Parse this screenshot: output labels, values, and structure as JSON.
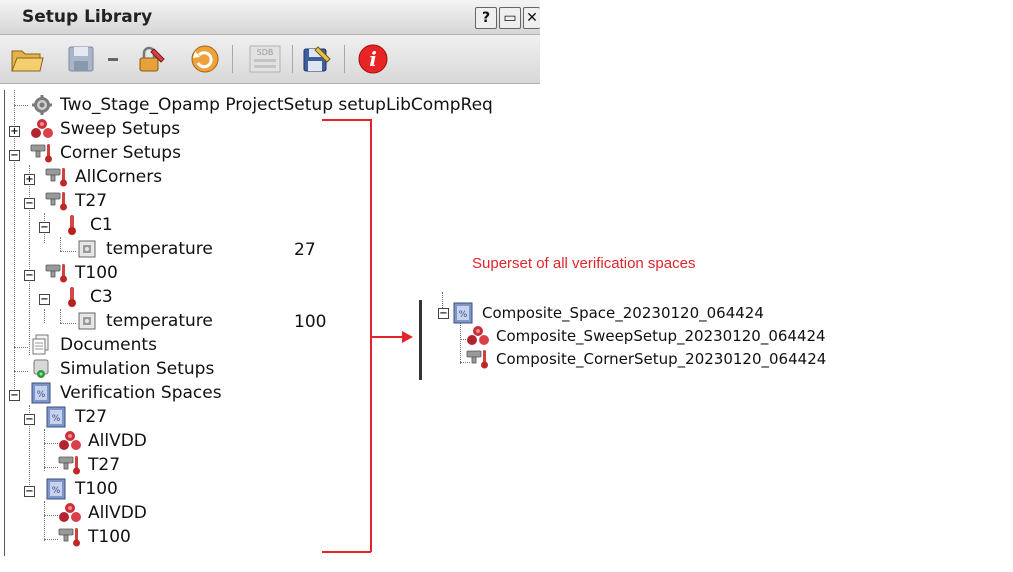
{
  "window": {
    "title": "Setup Library",
    "buttons": [
      "?",
      "▭",
      "✕"
    ]
  },
  "toolbar": {
    "icons": [
      "open-folder-icon",
      "save-icon",
      "minus-icon",
      "lock-edit-icon",
      "undo-icon",
      "sdb-icon",
      "save-edit-icon",
      "info-icon"
    ]
  },
  "tree": {
    "root": "Two_Stage_Opamp ProjectSetup setupLibCompReq",
    "sweep_setups": "Sweep Setups",
    "corner_setups": "Corner Setups",
    "all_corners": "AllCorners",
    "t27": "T27",
    "c1": "C1",
    "temperature1": "temperature",
    "temperature1_value": "27",
    "t100": "T100",
    "c3": "C3",
    "temperature2": "temperature",
    "temperature2_value": "100",
    "documents": "Documents",
    "simulation_setups": "Simulation Setups",
    "verification_spaces": "Verification Spaces",
    "vs_t27": "T27",
    "vs_t27_allvdd": "AllVDD",
    "vs_t27_t27": "T27",
    "vs_t100": "T100",
    "vs_t100_allvdd": "AllVDD",
    "vs_t100_t100": "T100"
  },
  "annotation": {
    "text": "Superset of all verification spaces",
    "color": "#e0252b"
  },
  "composite": {
    "space": "Composite_Space_20230120_064424",
    "sweep": "Composite_SweepSetup_20230120_064424",
    "corner": "Composite_CornerSetup_20230120_064424"
  }
}
